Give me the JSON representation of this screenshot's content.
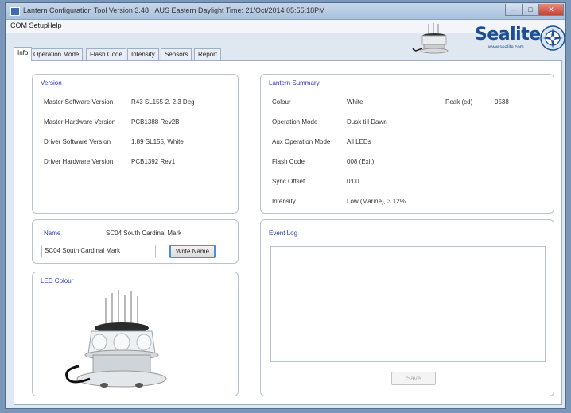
{
  "window": {
    "title": "Lantern Configuration Tool Version 3.48",
    "time_text": "AUS Eastern Daylight Time: 21/Oct/2014 05:55:18PM"
  },
  "menu": {
    "com_setup": "COM Setup",
    "help": "Help"
  },
  "brand": {
    "name": "Sealite",
    "url": "www.sealite.com"
  },
  "tabs": [
    "Info",
    "Operation Mode",
    "Flash Code",
    "Intensity",
    "Sensors",
    "Report"
  ],
  "version": {
    "title": "Version",
    "rows": [
      {
        "label": "Master Software Version",
        "value": "R43 SL155-2. 2.3 Deg"
      },
      {
        "label": "Master Hardware Version",
        "value": "PCB1388 Rev2B"
      },
      {
        "label": "Driver Software Version",
        "value": "1.89 SL155, White"
      },
      {
        "label": "Driver Hardware Version",
        "value": "PCB1392 Rev1"
      }
    ]
  },
  "name_panel": {
    "label": "Name",
    "value": "SC04 South Cardinal Mark",
    "input_value": "SC04 South Cardinal Mark",
    "write_button": "Write Name"
  },
  "led_colour": {
    "title": "LED Colour"
  },
  "lantern_summary": {
    "title": "Lantern Summary",
    "rows": [
      {
        "label": "Colour",
        "value": "White"
      },
      {
        "label": "Operation Mode",
        "value": "Dusk till Dawn"
      },
      {
        "label": "Aux Operation Mode",
        "value": "All LEDs"
      },
      {
        "label": "Flash Code",
        "value": "008 (Exit)"
      },
      {
        "label": "Sync Offset",
        "value": "0:00"
      },
      {
        "label": "Intensity",
        "value": "Low (Marine), 3.12%"
      }
    ],
    "peak_label": "Peak (cd)",
    "peak_value": "0538"
  },
  "event_log": {
    "title": "Event Log",
    "save_button": "Save"
  }
}
